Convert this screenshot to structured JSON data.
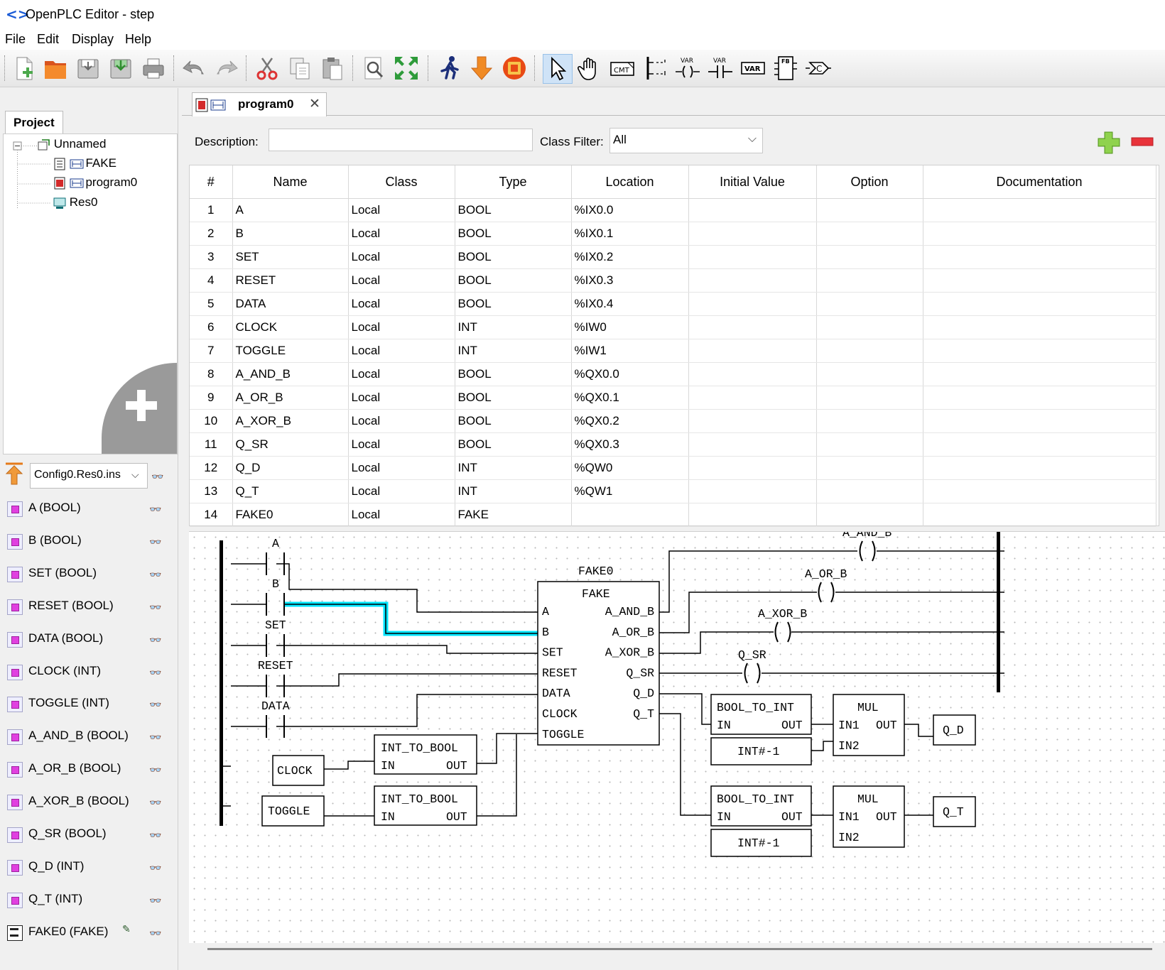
{
  "window": {
    "title": "OpenPLC Editor - step"
  },
  "menu": [
    "File",
    "Edit",
    "Display",
    "Help"
  ],
  "toolbar": {
    "icons": [
      "new-file-icon",
      "open-folder-icon",
      "save-icon",
      "save-as-icon",
      "print-icon",
      "undo-icon",
      "redo-icon",
      "cut-icon",
      "copy-icon",
      "paste-icon",
      "search-icon",
      "zoom-fit-icon",
      "run-icon",
      "download-arrow-icon",
      "stop-plc-icon",
      "select-pointer-icon",
      "hand-pan-icon",
      "comment-icon",
      "power-rail-icon",
      "coil-icon",
      "contact-icon",
      "variable-icon",
      "function-block-icon",
      "connection-icon"
    ],
    "labels": {
      "comment": "CMT",
      "var": "VAR",
      "fb": "FB",
      "conn": "C"
    }
  },
  "project": {
    "tab_label": "Project",
    "tree": [
      {
        "label": "Unnamed",
        "icon": "plc-project-icon",
        "selected": false
      },
      {
        "label": "FAKE",
        "icon": "function-block-pou-icon",
        "selected": false
      },
      {
        "label": "program0",
        "icon": "program-pou-icon",
        "selected": true
      },
      {
        "label": "Res0",
        "icon": "resource-icon",
        "selected": false
      }
    ]
  },
  "debug": {
    "instance": "Config0.Res0.ins",
    "variables": [
      "A (BOOL)",
      "B (BOOL)",
      "SET (BOOL)",
      "RESET (BOOL)",
      "DATA (BOOL)",
      "CLOCK (INT)",
      "TOGGLE (INT)",
      "A_AND_B (BOOL)",
      "A_OR_B (BOOL)",
      "A_XOR_B (BOOL)",
      "Q_SR (BOOL)",
      "Q_D (INT)",
      "Q_T (INT)",
      "FAKE0 (FAKE)"
    ]
  },
  "editor": {
    "tab_label": "program0",
    "description_label": "Description:",
    "description_value": "",
    "class_filter_label": "Class Filter:",
    "class_filter_value": "All",
    "columns": [
      "#",
      "Name",
      "Class",
      "Type",
      "Location",
      "Initial Value",
      "Option",
      "Documentation"
    ],
    "rows": [
      [
        "1",
        "A",
        "Local",
        "BOOL",
        "%IX0.0",
        "",
        "",
        ""
      ],
      [
        "2",
        "B",
        "Local",
        "BOOL",
        "%IX0.1",
        "",
        "",
        ""
      ],
      [
        "3",
        "SET",
        "Local",
        "BOOL",
        "%IX0.2",
        "",
        "",
        ""
      ],
      [
        "4",
        "RESET",
        "Local",
        "BOOL",
        "%IX0.3",
        "",
        "",
        ""
      ],
      [
        "5",
        "DATA",
        "Local",
        "BOOL",
        "%IX0.4",
        "",
        "",
        ""
      ],
      [
        "6",
        "CLOCK",
        "Local",
        "INT",
        "%IW0",
        "",
        "",
        ""
      ],
      [
        "7",
        "TOGGLE",
        "Local",
        "INT",
        "%IW1",
        "",
        "",
        ""
      ],
      [
        "8",
        "A_AND_B",
        "Local",
        "BOOL",
        "%QX0.0",
        "",
        "",
        ""
      ],
      [
        "9",
        "A_OR_B",
        "Local",
        "BOOL",
        "%QX0.1",
        "",
        "",
        ""
      ],
      [
        "10",
        "A_XOR_B",
        "Local",
        "BOOL",
        "%QX0.2",
        "",
        "",
        ""
      ],
      [
        "11",
        "Q_SR",
        "Local",
        "BOOL",
        "%QX0.3",
        "",
        "",
        ""
      ],
      [
        "12",
        "Q_D",
        "Local",
        "INT",
        "%QW0",
        "",
        "",
        ""
      ],
      [
        "13",
        "Q_T",
        "Local",
        "INT",
        "%QW1",
        "",
        "",
        ""
      ],
      [
        "14",
        "FAKE0",
        "Local",
        "FAKE",
        "",
        "",
        "",
        ""
      ]
    ]
  },
  "diagram": {
    "contacts": [
      "A",
      "B",
      "SET",
      "RESET",
      "DATA"
    ],
    "fb_instance": "FAKE0",
    "fb_type": "FAKE",
    "fb_inputs": [
      "A",
      "B",
      "SET",
      "RESET",
      "DATA",
      "CLOCK",
      "TOGGLE"
    ],
    "fb_outputs": [
      "A_AND_B",
      "A_OR_B",
      "A_XOR_B",
      "Q_SR",
      "Q_D",
      "Q_T"
    ],
    "coils": [
      "A_AND_B",
      "A_OR_B",
      "A_XOR_B",
      "Q_SR"
    ],
    "in_vars": [
      "CLOCK",
      "TOGGLE"
    ],
    "out_vars": [
      "Q_D",
      "Q_T"
    ],
    "int_to_bool": {
      "name": "INT_TO_BOOL",
      "in": "IN",
      "out": "OUT"
    },
    "bool_to_int": {
      "name": "BOOL_TO_INT",
      "in": "IN",
      "out": "OUT"
    },
    "mul": {
      "name": "MUL",
      "in1": "IN1",
      "in2": "IN2",
      "out": "OUT"
    },
    "const": "INT#-1",
    "highlight_color": "#00e5ff"
  }
}
